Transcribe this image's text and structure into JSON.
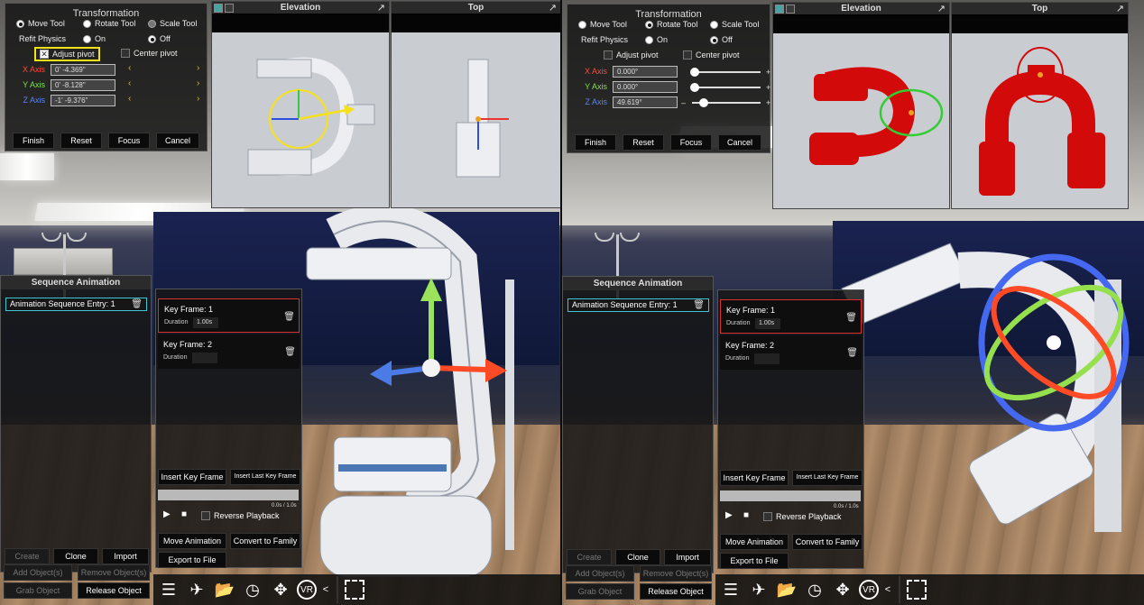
{
  "transformation": {
    "title": "Transformation",
    "tools": [
      "Move Tool",
      "Rotate Tool",
      "Scale Tool"
    ],
    "refit_label": "Refit Physics",
    "on_label": "On",
    "off_label": "Off",
    "adjust_pivot": "Adjust pivot",
    "center_pivot": "Center pivot",
    "axes": [
      "X Axis",
      "Y Axis",
      "Z Axis"
    ],
    "buttons": [
      "Finish",
      "Reset",
      "Focus",
      "Cancel"
    ]
  },
  "left": {
    "axis_values": [
      "0' -4.369\"",
      "0' -8.128\"",
      "-1' -9.376\""
    ]
  },
  "right": {
    "axis_values": [
      "0.000°",
      "0.000°",
      "49.619°"
    ]
  },
  "viewports": {
    "elevation": "Elevation",
    "top": "Top",
    "expand_glyph": "↗"
  },
  "sequence": {
    "title": "Sequence Animation",
    "entry": "Animation Sequence Entry: 1",
    "create": "Create",
    "clone": "Clone",
    "import": "Import",
    "add_objects": "Add Object(s)",
    "remove_objects": "Remove Object(s)",
    "grab": "Grab Object",
    "release": "Release Object"
  },
  "keyframes": {
    "items": [
      {
        "name": "Key Frame: 1",
        "duration_label": "Duration",
        "duration": "1.00s"
      },
      {
        "name": "Key Frame: 2",
        "duration_label": "Duration",
        "duration": ""
      }
    ],
    "insert": "Insert Key Frame",
    "insert_last": "Insert Last Key Frame",
    "time": "0.0s / 1.0s",
    "reverse": "Reverse Playback",
    "move_anim": "Move Animation",
    "convert": "Convert to Family",
    "export": "Export to File"
  },
  "toolbar": {
    "icons": [
      "list-icon",
      "plane-icon",
      "folder-icon",
      "clock-icon",
      "move-arrows-icon",
      "vr-icon"
    ],
    "vr_label": "VR",
    "collapse": "<"
  },
  "colors": {
    "x_axis": "#ff3b2f",
    "y_axis": "#7fe04a",
    "z_axis": "#3f6df0",
    "highlight_red": "#d83030",
    "highlight_cyan": "#3ec7d4",
    "highlight_yellow": "#f5e11a"
  }
}
